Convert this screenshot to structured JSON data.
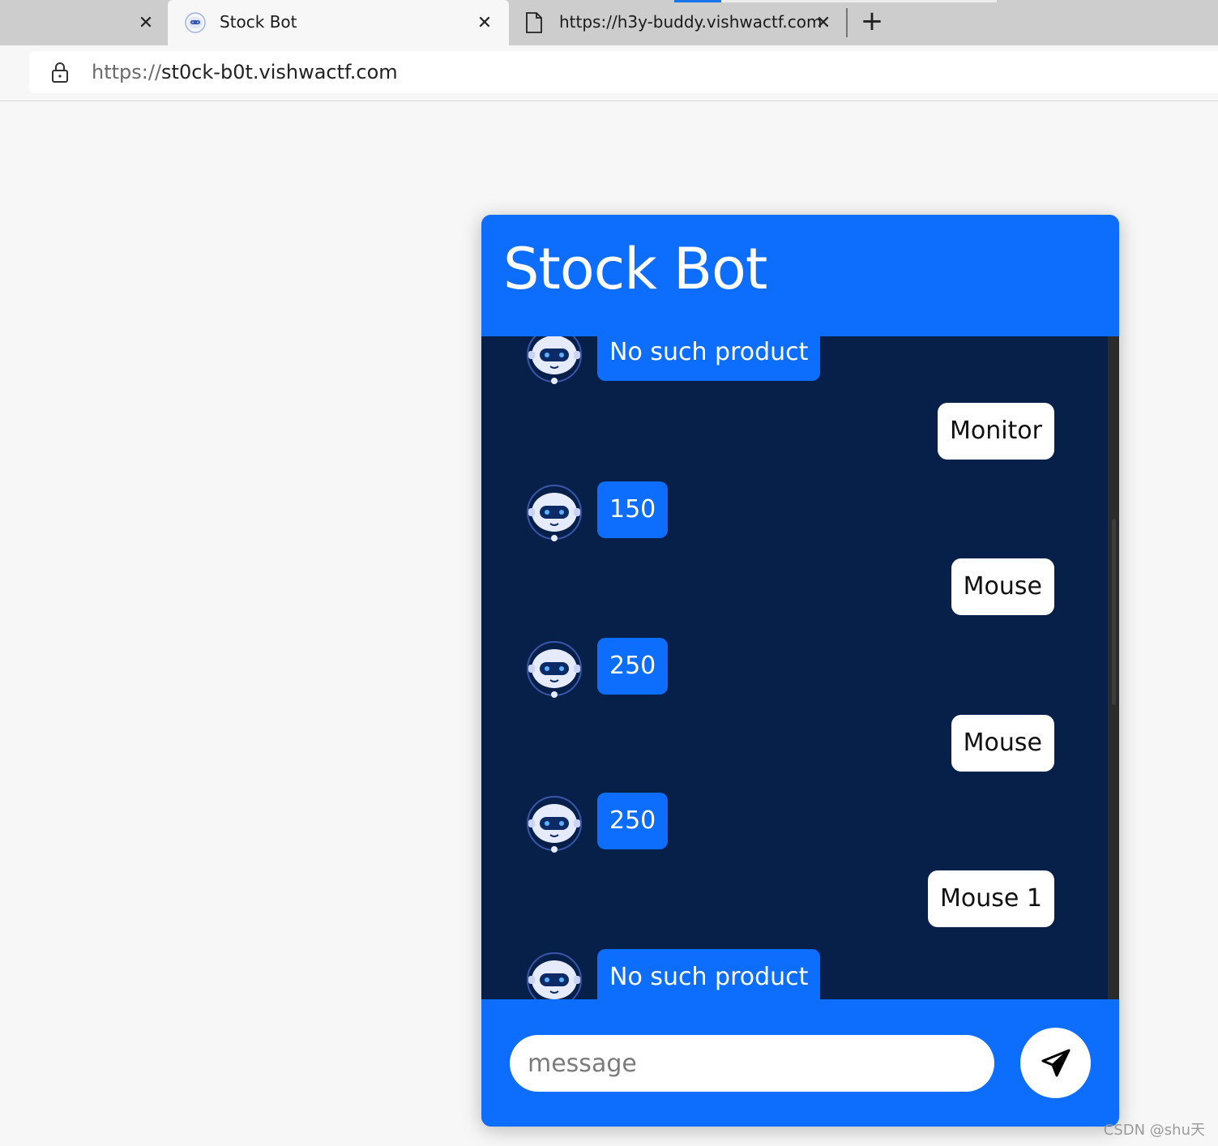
{
  "browser": {
    "tabs": [
      {
        "title": "",
        "close_label": "✕"
      },
      {
        "title": "Stock Bot",
        "close_label": "✕"
      },
      {
        "title": "https://h3y-buddy.vishwactf.com",
        "close_label": "✕"
      }
    ],
    "new_tab_label": "+",
    "address": {
      "scheme": "https://",
      "host": "st0ck-b0t.vishwactf.com"
    }
  },
  "chat": {
    "title": "Stock Bot",
    "messages": [
      {
        "sender": "bot",
        "text": "No such product"
      },
      {
        "sender": "user",
        "text": "Monitor"
      },
      {
        "sender": "bot",
        "text": "150"
      },
      {
        "sender": "user",
        "text": "Mouse"
      },
      {
        "sender": "bot",
        "text": "250"
      },
      {
        "sender": "user",
        "text": "Mouse"
      },
      {
        "sender": "bot",
        "text": "250"
      },
      {
        "sender": "user",
        "text": "Mouse 1"
      },
      {
        "sender": "bot",
        "text": "No such product"
      }
    ],
    "input": {
      "placeholder": "message",
      "value": ""
    },
    "send_icon": "paper-plane-icon"
  },
  "watermark": "CSDN @shu天",
  "colors": {
    "header_blue": "#0d6efd",
    "chat_background": "#06204a",
    "user_bubble": "#ffffff",
    "bot_bubble": "#0d6efd"
  }
}
